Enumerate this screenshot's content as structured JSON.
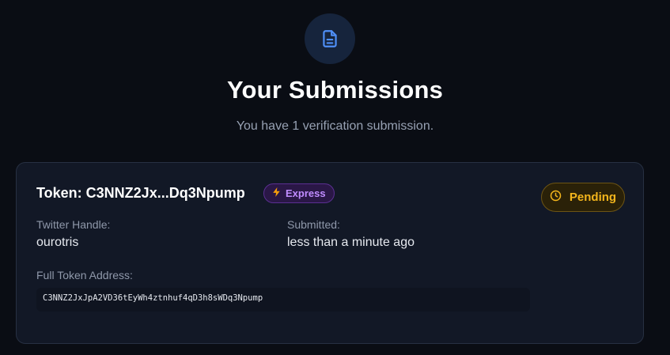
{
  "header": {
    "icon": "document-icon",
    "title": "Your Submissions",
    "subtitle": "You have 1 verification submission."
  },
  "submission": {
    "token_title": "Token: C3NNZ2Jx...Dq3Npump",
    "express_badge": "Express",
    "status": "Pending",
    "twitter_label": "Twitter Handle:",
    "twitter_value": "ourotris",
    "submitted_label": "Submitted:",
    "submitted_value": "less than a minute ago",
    "address_label": "Full Token Address:",
    "address_value": "C3NNZ2JxJpA2VD36tEyWh4ztnhuf4qD3h8sWDq3Npump"
  },
  "colors": {
    "background": "#0a0d14",
    "card": "#121826",
    "accent_blue": "#4f8ff7",
    "express_purple": "#c08cff",
    "pending_amber": "#f3b51c"
  }
}
